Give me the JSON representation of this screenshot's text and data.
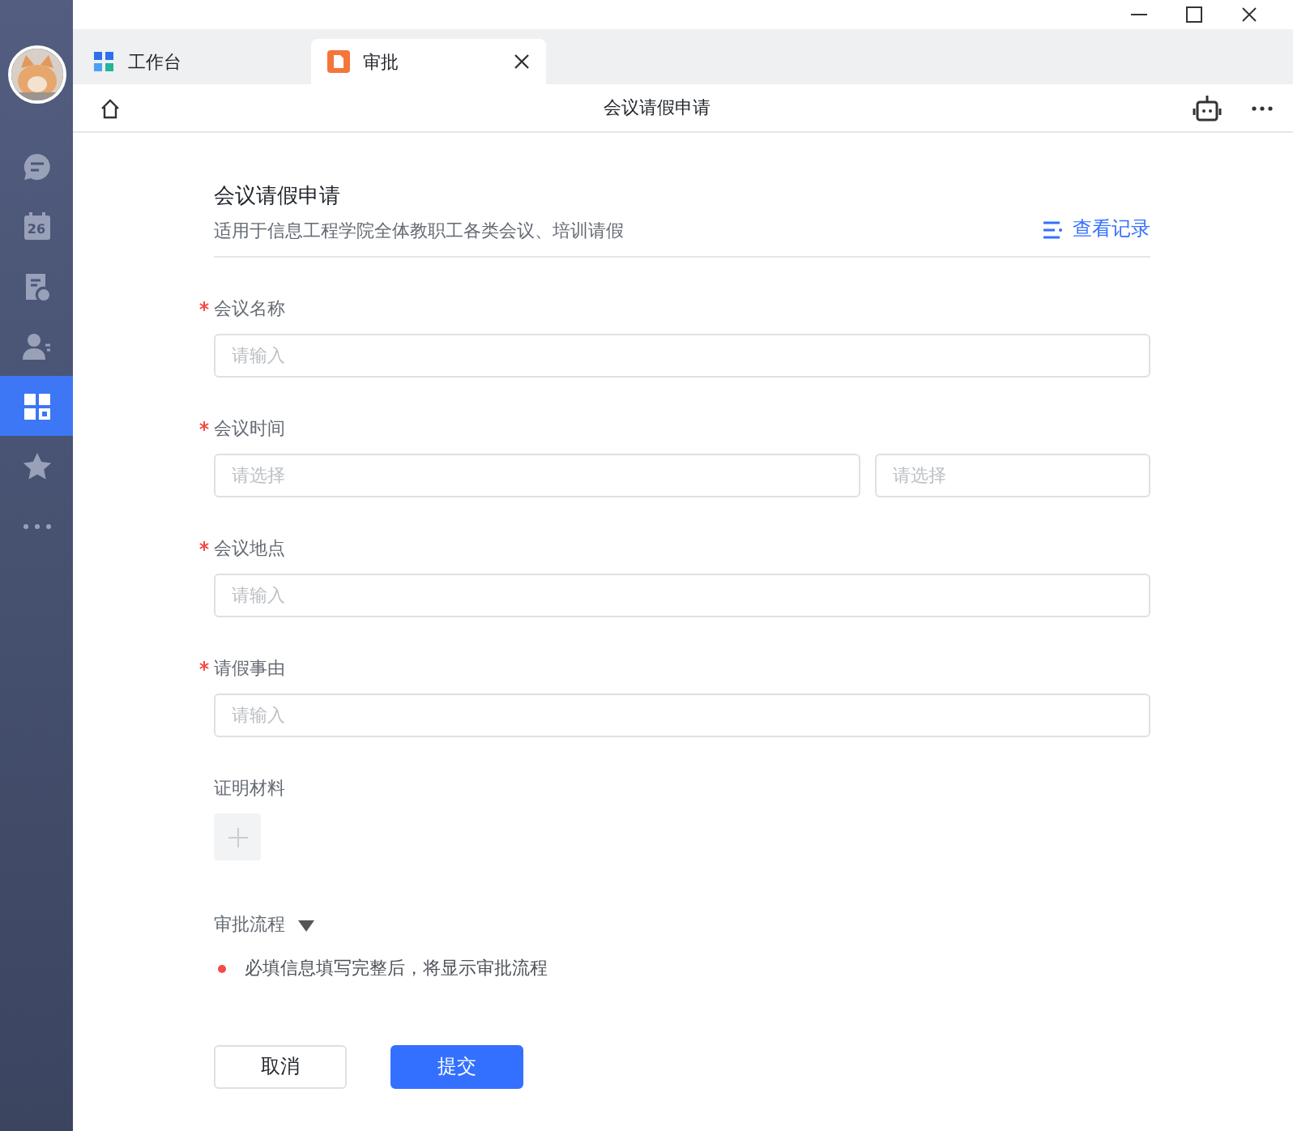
{
  "sidebar": {
    "items": [
      {
        "kind": "chat",
        "selected": false
      },
      {
        "kind": "calendar",
        "date": "26",
        "selected": false
      },
      {
        "kind": "approval",
        "selected": false
      },
      {
        "kind": "contacts",
        "selected": false
      },
      {
        "kind": "workbench",
        "selected": true
      },
      {
        "kind": "favorites",
        "selected": false
      },
      {
        "kind": "more",
        "selected": false
      }
    ]
  },
  "tabs": [
    {
      "label": "工作台",
      "kind": "workbench",
      "selected": false,
      "closable": false
    },
    {
      "label": "审批",
      "kind": "approval",
      "selected": true,
      "closable": true
    }
  ],
  "toolbar": {
    "title": "会议请假申请"
  },
  "form": {
    "title": "会议请假申请",
    "description": "适用于信息工程学院全体教职工各类会议、培训请假",
    "records_link": "查看记录",
    "fields": [
      {
        "kind": "input",
        "label": "会议名称",
        "required": true,
        "placeholder": "请输入"
      },
      {
        "kind": "range",
        "label": "会议时间",
        "required": true,
        "placeholders": [
          "请选择",
          "请选择"
        ]
      },
      {
        "kind": "input",
        "label": "会议地点",
        "required": true,
        "placeholder": "请输入"
      },
      {
        "kind": "input",
        "label": "请假事由",
        "required": true,
        "placeholder": "请输入"
      },
      {
        "kind": "upload",
        "label": "证明材料",
        "required": false
      }
    ],
    "flow": {
      "label": "审批流程",
      "expanded": true,
      "notice": "必填信息填写完整后，将显示审批流程"
    },
    "buttons": [
      {
        "label": "取消",
        "kind": "secondary"
      },
      {
        "label": "提交",
        "kind": "primary"
      }
    ]
  }
}
